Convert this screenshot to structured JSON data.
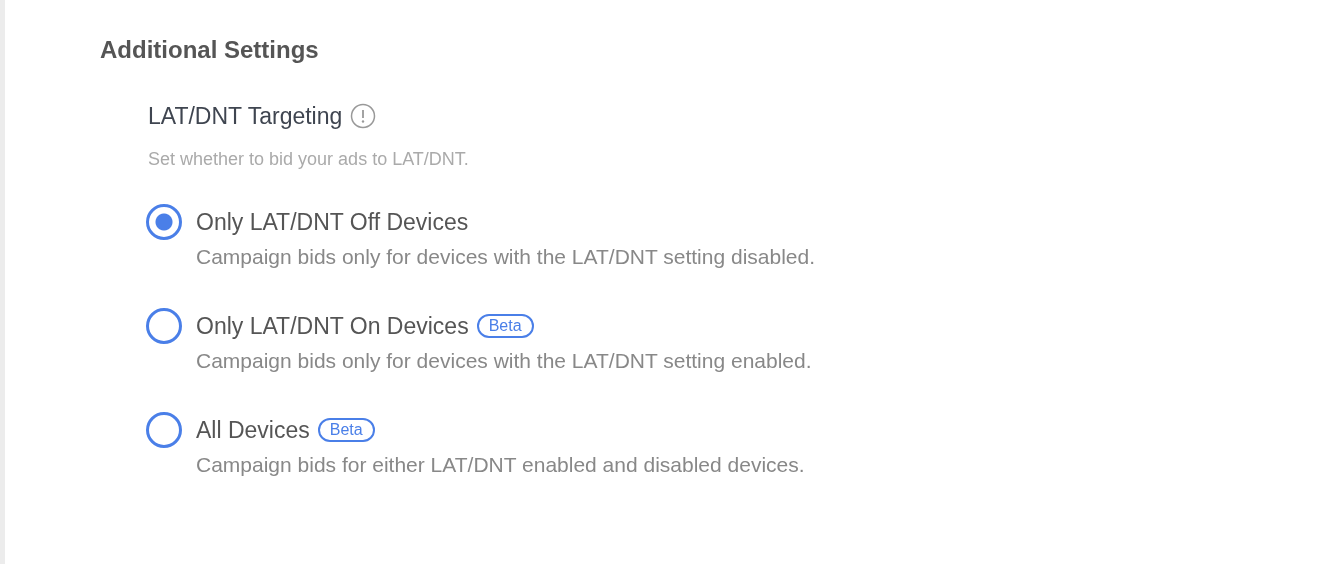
{
  "section": {
    "title": "Additional Settings"
  },
  "setting": {
    "label": "LAT/DNT Targeting",
    "hint": "Set whether to bid your ads to LAT/DNT.",
    "options": [
      {
        "label": "Only LAT/DNT Off Devices",
        "description": "Campaign bids only for devices with the LAT/DNT setting disabled.",
        "selected": true
      },
      {
        "label": "Only LAT/DNT On Devices",
        "badge": "Beta",
        "description": "Campaign bids only for devices with the LAT/DNT setting enabled.",
        "selected": false
      },
      {
        "label": "All Devices",
        "badge": "Beta",
        "description": "Campaign bids for either LAT/DNT enabled and disabled devices.",
        "selected": false
      }
    ]
  }
}
